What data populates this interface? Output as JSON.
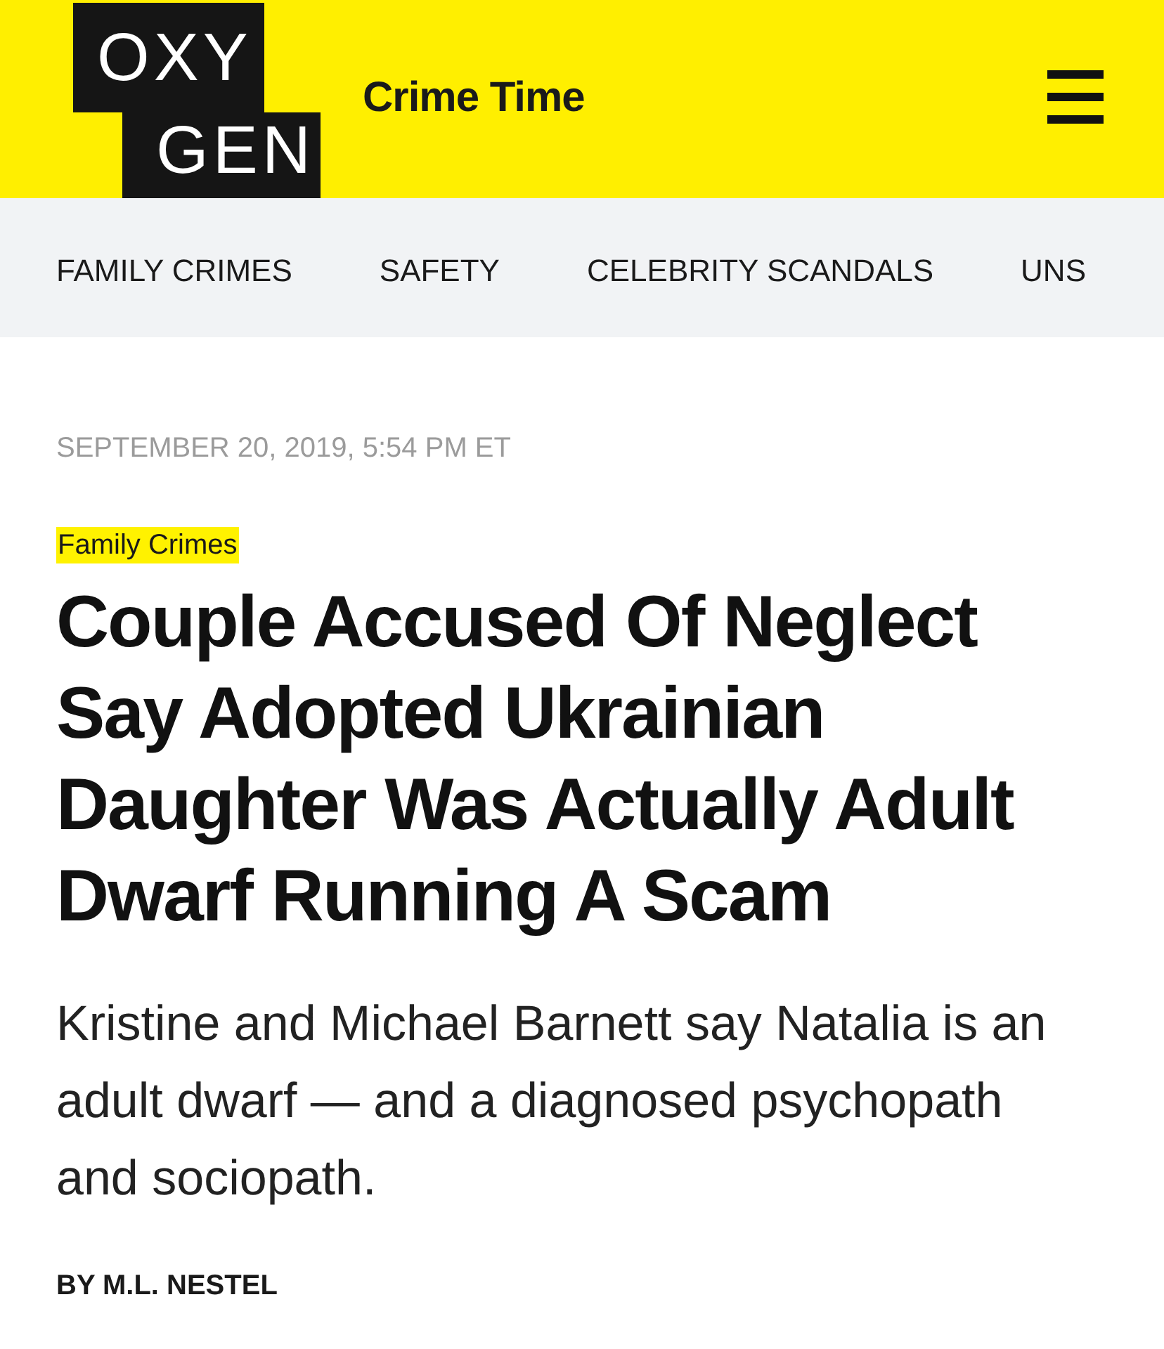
{
  "header": {
    "logo": [
      "OXY",
      "GEN"
    ],
    "section_title": "Crime Time"
  },
  "nav": {
    "items": [
      "FAMILY CRIMES",
      "SAFETY",
      "CELEBRITY SCANDALS",
      "UNS"
    ]
  },
  "article": {
    "date": "SEPTEMBER 20, 2019, 5:54 PM ET",
    "category": "Family Crimes",
    "headline": "Couple Accused Of Neglect Say Adopted Ukrainian Daughter Was Actually Adult Dwarf Running A Scam",
    "dek": "Kristine and Michael Barnett say Natalia is an adult dwarf — and a diagnosed psychopath and sociopath.",
    "byline": "BY M.L. NESTEL"
  }
}
